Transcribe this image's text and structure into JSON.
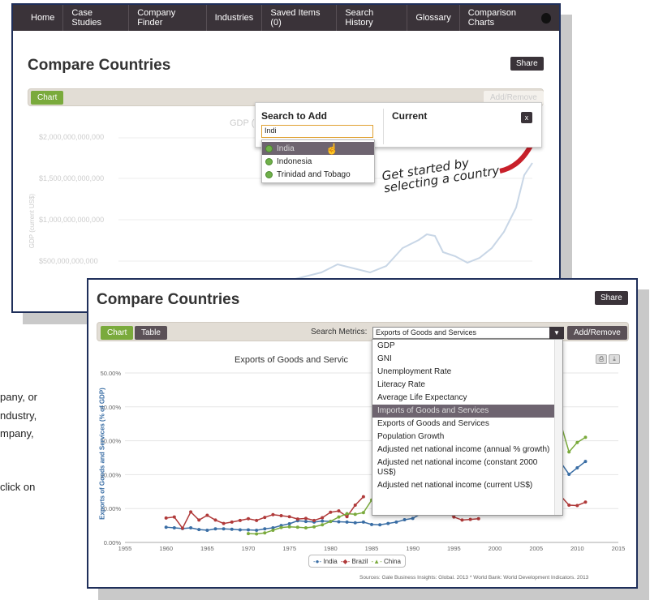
{
  "nav": {
    "items": [
      "Home",
      "Case Studies",
      "Company Finder",
      "Industries",
      "Saved Items (0)",
      "Search History",
      "Glossary",
      "Comparison Charts"
    ]
  },
  "page_title": "Compare Countries",
  "share_label": "Share",
  "chart_btn": "Chart",
  "table_btn": "Table",
  "add_remove": "Add/Remove",
  "search_panel": {
    "title": "Search to Add",
    "current": "Current",
    "input_value": "Indi",
    "close": "x",
    "options": [
      "India",
      "Indonesia",
      "Trinidad and Tobago"
    ]
  },
  "handwritten": "Get started by selecting a country",
  "gdp_chart": {
    "title_fragment": "GDP (",
    "ylabel": "GDP (current US$)",
    "ticks": [
      "$2,000,000,000,000",
      "$1,500,000,000,000",
      "$1,000,000,000,000",
      "$500,000,000,000"
    ]
  },
  "search_metrics": {
    "label": "Search Metrics:",
    "selected": "Exports of Goods and Services",
    "options": [
      "GDP",
      "GNI",
      "Unemployment Rate",
      "Literacy Rate",
      "Average Life Expectancy",
      "Imports of Goods and Services",
      "Exports of Goods and Services",
      "Population Growth",
      "Adjusted net national income (annual % growth)",
      "Adjusted net national income (constant 2000 US$)",
      "Adjusted net national income (current US$)"
    ]
  },
  "bg_text": [
    "pany, or",
    "ndustry,",
    "mpany,",
    "click on"
  ],
  "source": "Sources: Gale Business Insights: Global. 2013 * World Bank: World Development Indicators. 2013",
  "colors": {
    "nav": "#3a3339",
    "accent": "#7aaa3c",
    "frame": "#1f2f5a"
  },
  "chart_data": {
    "type": "line",
    "title": "Exports of Goods and Servic",
    "ylabel": "Exports of Goods and Services (% of GDP)",
    "xlim": [
      1955,
      2015
    ],
    "ylim": [
      0,
      50
    ],
    "yticks": [
      "0.00%",
      "10.00%",
      "20.00%",
      "30.00%",
      "40.00%",
      "50.00%"
    ],
    "xticks": [
      "1955",
      "1960",
      "1965",
      "1970",
      "1975",
      "1980",
      "1985",
      "1990",
      "1995",
      "2000",
      "2005",
      "2010",
      "2015"
    ],
    "series": [
      {
        "name": "India",
        "color": "#3a6ea5",
        "points": [
          [
            1960,
            4.5
          ],
          [
            1961,
            4.3
          ],
          [
            1962,
            4.1
          ],
          [
            1963,
            4.3
          ],
          [
            1964,
            3.8
          ],
          [
            1965,
            3.6
          ],
          [
            1966,
            4.0
          ],
          [
            1967,
            4.0
          ],
          [
            1968,
            3.9
          ],
          [
            1969,
            3.7
          ],
          [
            1970,
            3.7
          ],
          [
            1971,
            3.6
          ],
          [
            1972,
            4.0
          ],
          [
            1973,
            4.3
          ],
          [
            1974,
            5.0
          ],
          [
            1975,
            5.5
          ],
          [
            1976,
            6.4
          ],
          [
            1977,
            6.2
          ],
          [
            1978,
            6.0
          ],
          [
            1979,
            6.3
          ],
          [
            1980,
            6.2
          ],
          [
            1981,
            6.1
          ],
          [
            1982,
            6.0
          ],
          [
            1983,
            5.8
          ],
          [
            1984,
            6.0
          ],
          [
            1985,
            5.3
          ],
          [
            1986,
            5.2
          ],
          [
            1987,
            5.6
          ],
          [
            1988,
            6.0
          ],
          [
            1989,
            6.7
          ],
          [
            1990,
            7.1
          ],
          [
            1991,
            8.5
          ],
          [
            2007,
            20.4
          ],
          [
            2008,
            23.6
          ],
          [
            2009,
            20.1
          ],
          [
            2010,
            22.0
          ],
          [
            2011,
            23.9
          ]
        ]
      },
      {
        "name": "Brazil",
        "color": "#b03a3a",
        "points": [
          [
            1960,
            7.2
          ],
          [
            1961,
            7.5
          ],
          [
            1962,
            4.2
          ],
          [
            1963,
            9.0
          ],
          [
            1964,
            6.6
          ],
          [
            1965,
            8.0
          ],
          [
            1966,
            6.6
          ],
          [
            1967,
            5.6
          ],
          [
            1968,
            6.0
          ],
          [
            1969,
            6.5
          ],
          [
            1970,
            7.0
          ],
          [
            1971,
            6.5
          ],
          [
            1972,
            7.4
          ],
          [
            1973,
            8.2
          ],
          [
            1974,
            7.9
          ],
          [
            1975,
            7.6
          ],
          [
            1976,
            6.9
          ],
          [
            1977,
            7.1
          ],
          [
            1978,
            6.5
          ],
          [
            1979,
            7.3
          ],
          [
            1980,
            8.9
          ],
          [
            1981,
            9.3
          ],
          [
            1982,
            7.6
          ],
          [
            1983,
            11.0
          ],
          [
            1984,
            13.5
          ],
          [
            1994,
            9.6
          ],
          [
            1995,
            7.5
          ],
          [
            1996,
            6.6
          ],
          [
            1997,
            6.8
          ],
          [
            1998,
            7.0
          ],
          [
            2008,
            13.7
          ],
          [
            2009,
            11.0
          ],
          [
            2010,
            10.9
          ],
          [
            2011,
            11.9
          ]
        ]
      },
      {
        "name": "China",
        "color": "#7aaa3c",
        "points": [
          [
            1970,
            2.6
          ],
          [
            1971,
            2.5
          ],
          [
            1972,
            2.8
          ],
          [
            1973,
            3.6
          ],
          [
            1974,
            4.4
          ],
          [
            1975,
            4.6
          ],
          [
            1976,
            4.5
          ],
          [
            1977,
            4.3
          ],
          [
            1978,
            4.6
          ],
          [
            1979,
            5.2
          ],
          [
            1980,
            6.2
          ],
          [
            1981,
            7.5
          ],
          [
            1982,
            8.5
          ],
          [
            1983,
            8.3
          ],
          [
            1984,
            8.8
          ],
          [
            1985,
            12.5
          ],
          [
            2007,
            38.0
          ],
          [
            2008,
            35.0
          ],
          [
            2009,
            26.7
          ],
          [
            2010,
            29.5
          ],
          [
            2011,
            31.0
          ]
        ]
      }
    ]
  }
}
